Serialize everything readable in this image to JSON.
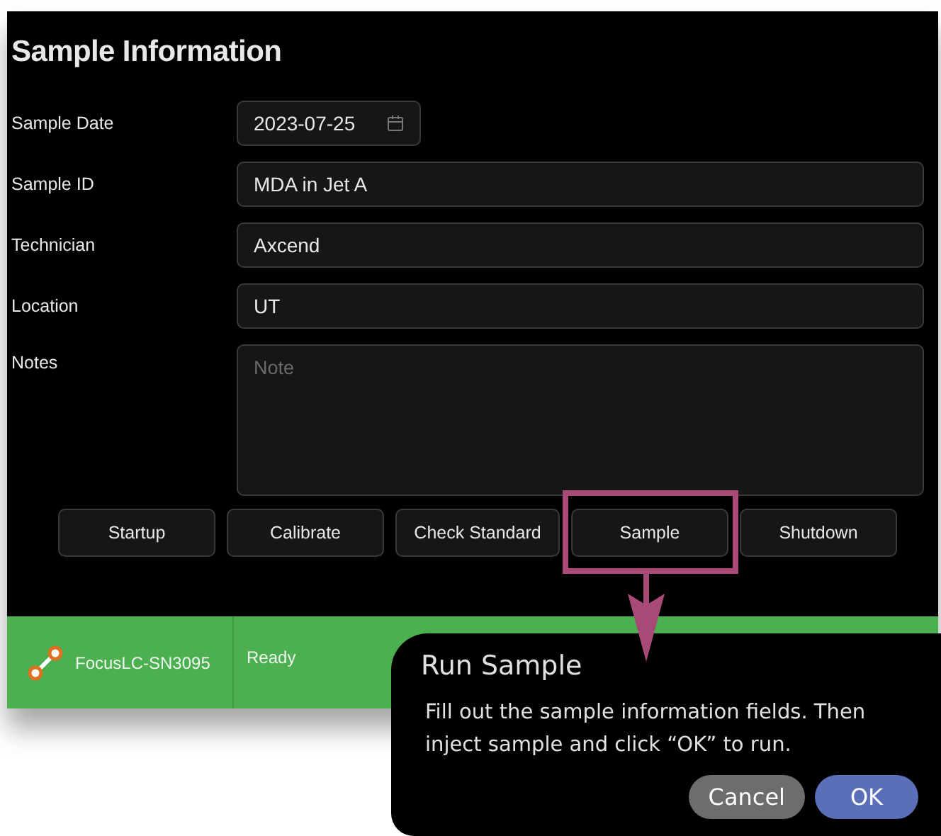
{
  "title": "Sample Information",
  "fields": [
    {
      "label": "Sample Date",
      "kind": "date",
      "value": "2023-07-25"
    },
    {
      "label": "Sample ID",
      "kind": "text",
      "value": "MDA in Jet A"
    },
    {
      "label": "Technician",
      "kind": "text",
      "value": "Axcend"
    },
    {
      "label": "Location",
      "kind": "text",
      "value": "UT"
    },
    {
      "label": "Notes",
      "kind": "textarea",
      "placeholder": "Note"
    }
  ],
  "buttons": [
    {
      "label": "Startup",
      "highlighted": false
    },
    {
      "label": "Calibrate",
      "highlighted": false
    },
    {
      "label": "Check Standard",
      "highlighted": false
    },
    {
      "label": "Sample",
      "highlighted": true
    },
    {
      "label": "Shutdown",
      "highlighted": false
    }
  ],
  "status_bar": {
    "device": "FocusLC-SN3095",
    "status": "Ready"
  },
  "callout": {
    "title": "Run Sample",
    "text": "Fill out the sample information fields. Then inject sample and click “OK” to run.",
    "buttons": [
      {
        "label": "Cancel",
        "kind": "secondary"
      },
      {
        "label": "OK",
        "kind": "primary"
      }
    ]
  }
}
